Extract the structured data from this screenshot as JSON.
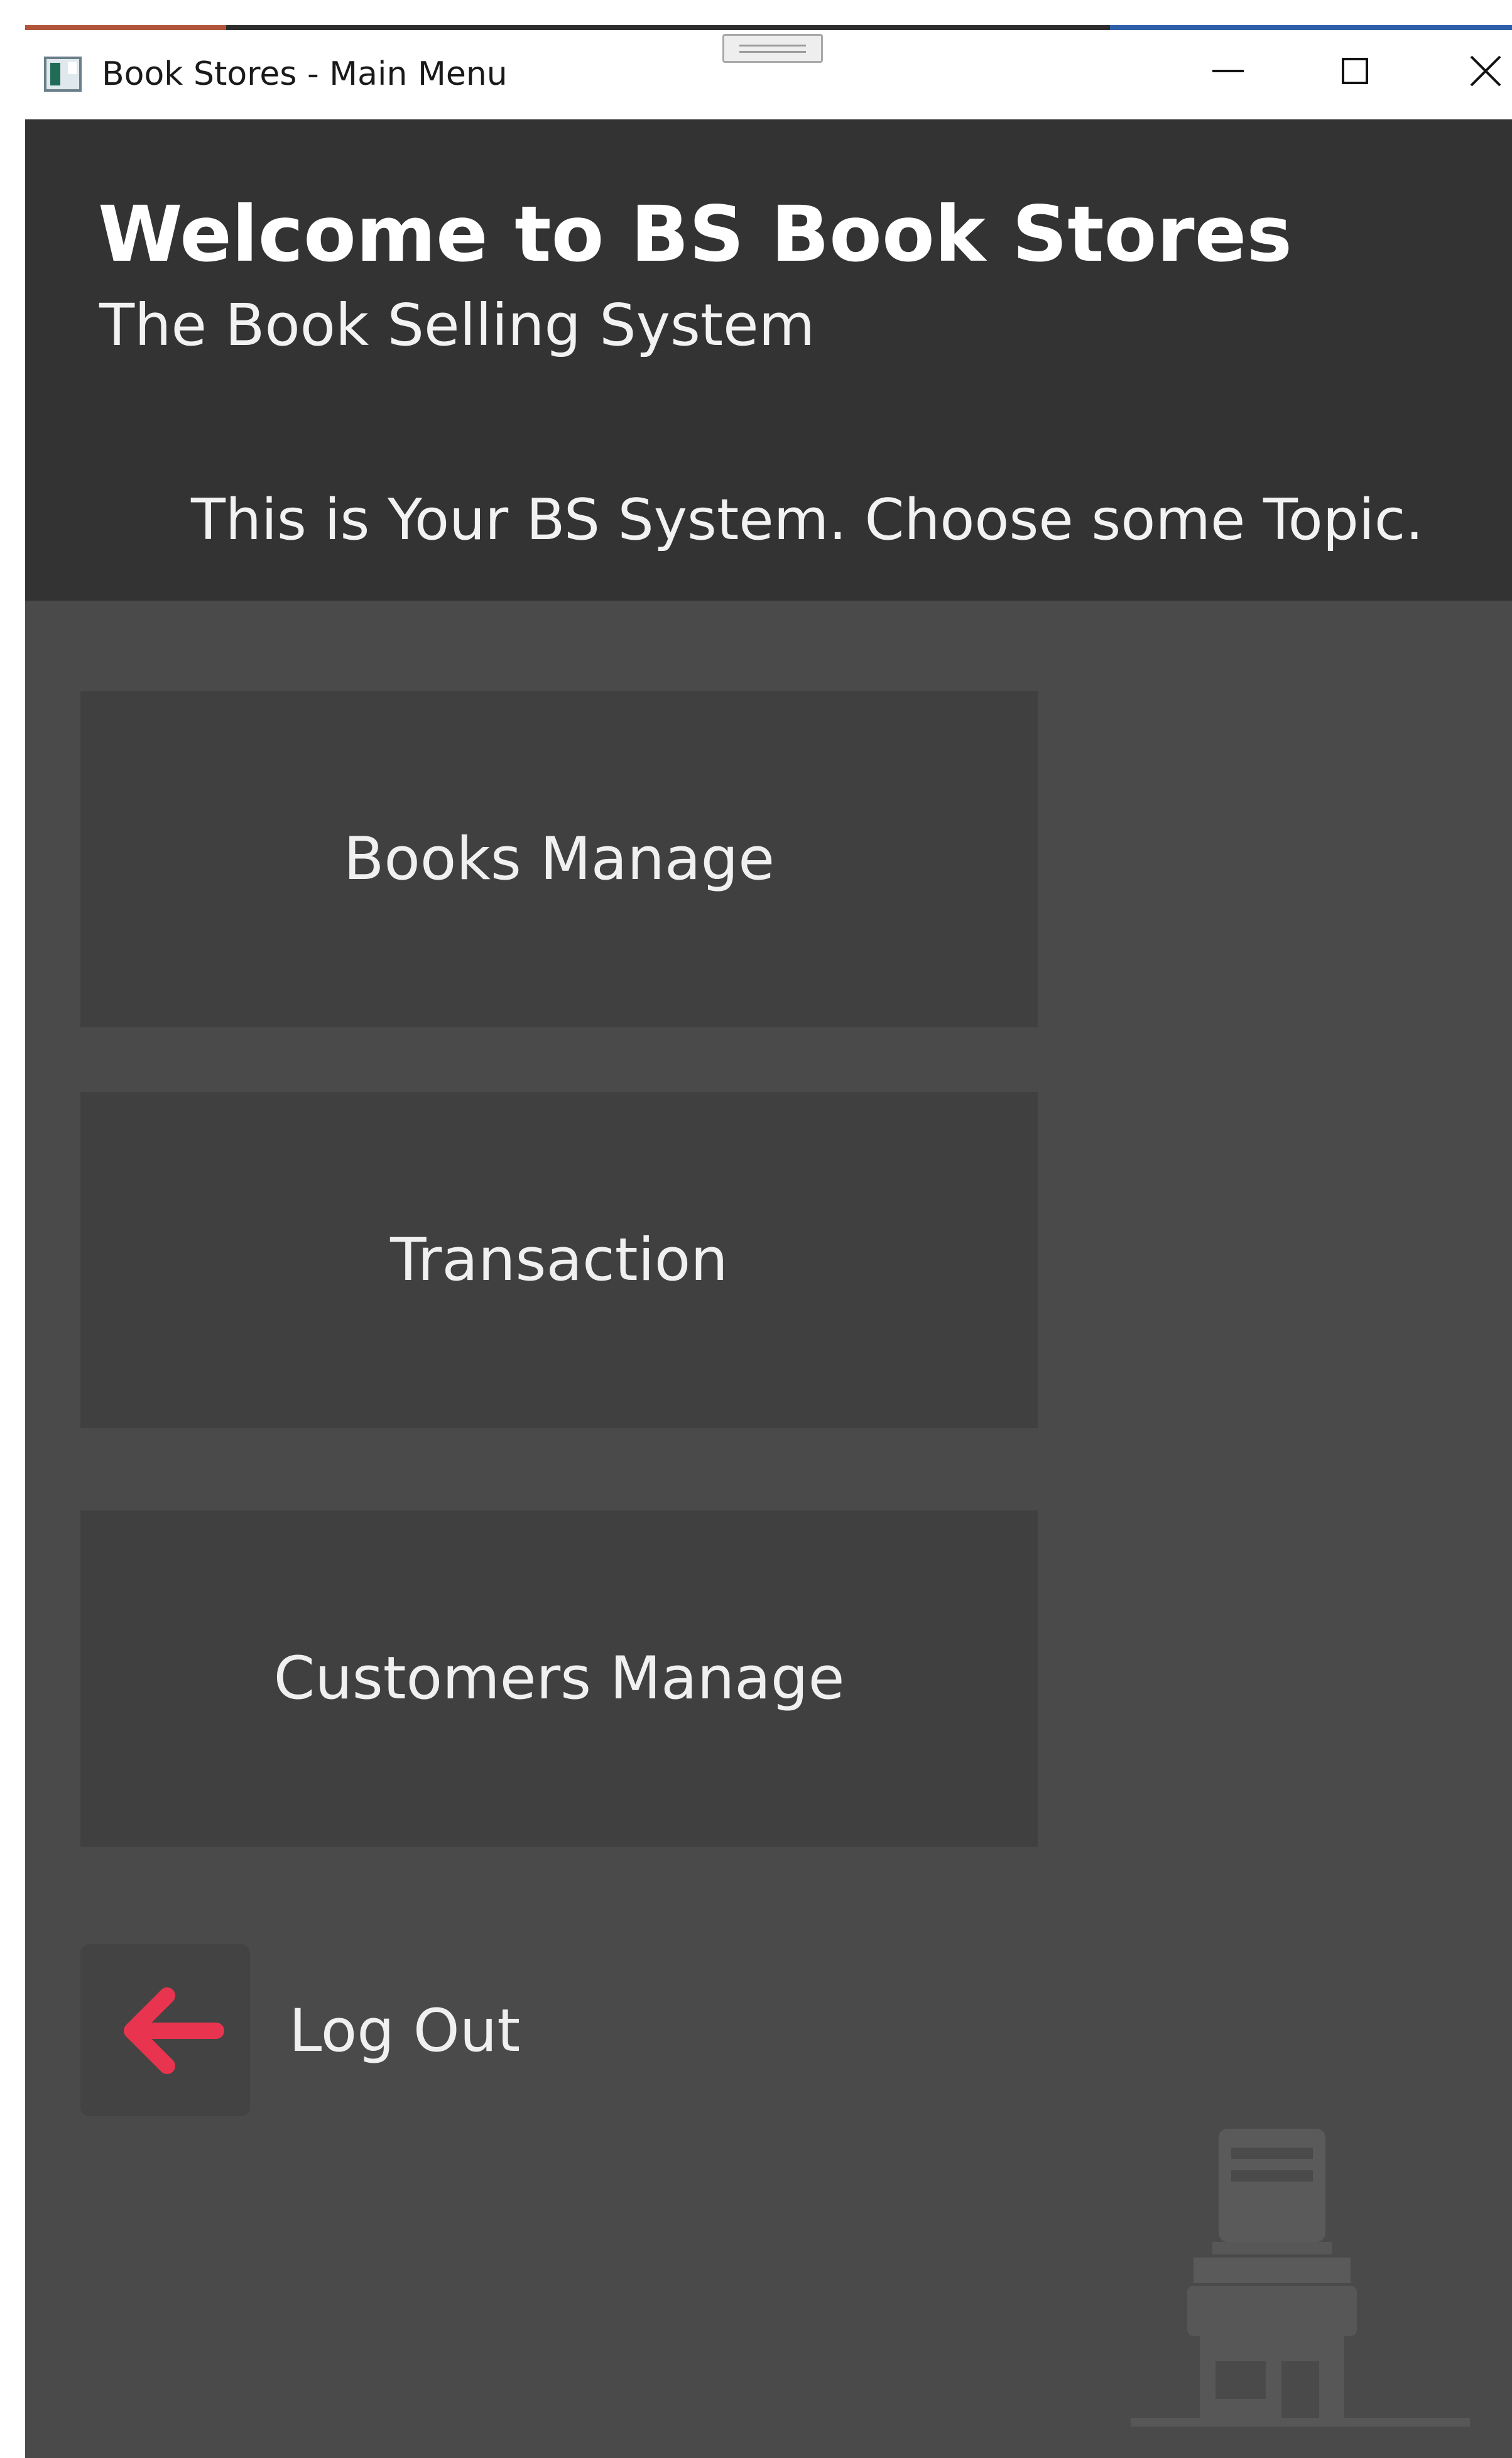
{
  "window": {
    "title": "Book Stores - Main Menu",
    "controls": {
      "minimize": "minimize-icon",
      "maximize": "maximize-icon",
      "close": "close-icon"
    }
  },
  "header": {
    "welcome": "Welcome to BS Book Stores",
    "subtitle": "The Book Selling System",
    "prompt": "This is Your BS System. Choose some Topic."
  },
  "menu": {
    "items": [
      {
        "label": "Books Manage"
      },
      {
        "label": "Transaction"
      },
      {
        "label": "Customers Manage"
      }
    ]
  },
  "logout": {
    "label": "Log Out",
    "icon": "arrow-left-icon"
  },
  "decor": {
    "icon": "store-icon"
  },
  "colors": {
    "header_bg": "#333333",
    "body_bg": "#4a4a4a",
    "button_bg": "#404040",
    "logout_arrow": "#e8344e",
    "text": "#f0f0f0"
  }
}
